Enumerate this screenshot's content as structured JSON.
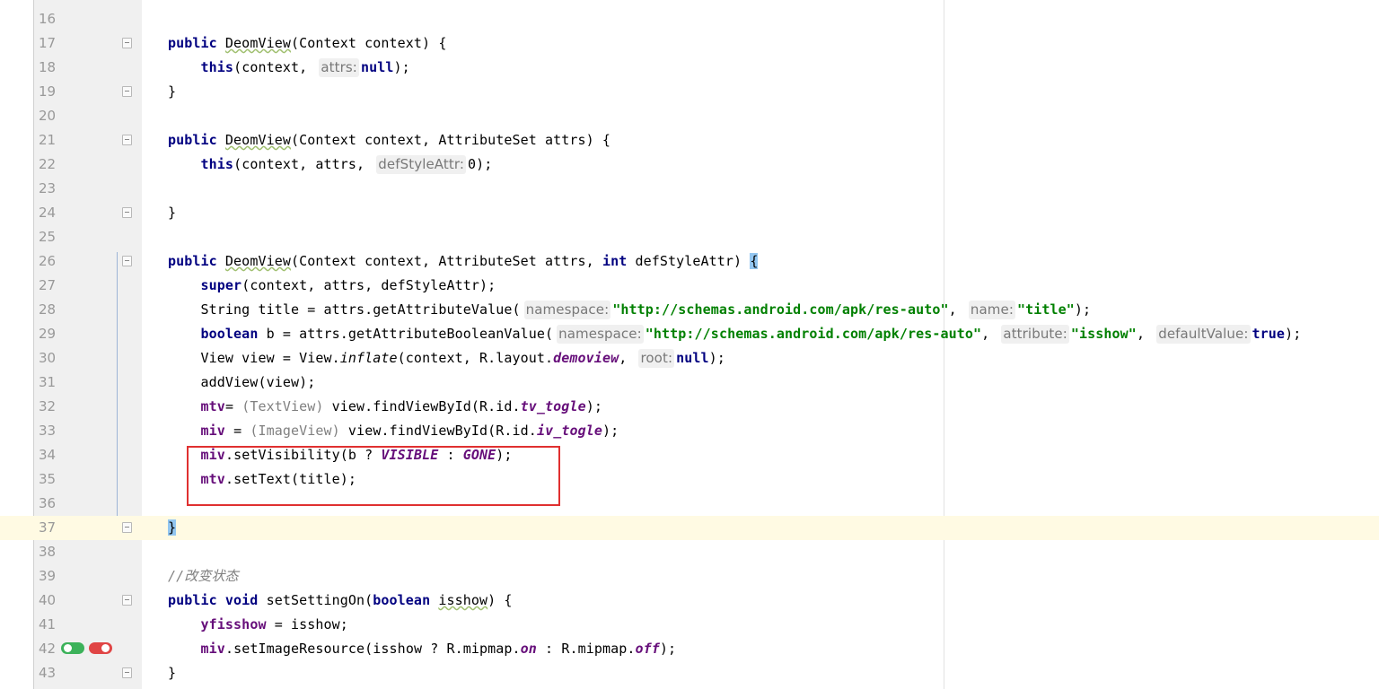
{
  "editor": {
    "lines": [
      {
        "num": "16",
        "segs": []
      },
      {
        "num": "17",
        "fold": true,
        "segs": [
          {
            "t": "public ",
            "c": "kw"
          },
          {
            "t": "DeomView",
            "c": "warn"
          },
          {
            "t": "(Context context) {"
          }
        ]
      },
      {
        "num": "18",
        "segs": [
          {
            "t": "    "
          },
          {
            "t": "this",
            "c": "kw"
          },
          {
            "t": "(context, "
          },
          {
            "t": "attrs:",
            "c": "hint"
          },
          {
            "t": "null",
            "c": "kw"
          },
          {
            "t": ");"
          }
        ]
      },
      {
        "num": "19",
        "fold": true,
        "segs": [
          {
            "t": "}"
          }
        ]
      },
      {
        "num": "20",
        "segs": []
      },
      {
        "num": "21",
        "fold": true,
        "segs": [
          {
            "t": "public ",
            "c": "kw"
          },
          {
            "t": "DeomView",
            "c": "warn"
          },
          {
            "t": "(Context context, AttributeSet attrs) {"
          }
        ]
      },
      {
        "num": "22",
        "segs": [
          {
            "t": "    "
          },
          {
            "t": "this",
            "c": "kw"
          },
          {
            "t": "(context, attrs, "
          },
          {
            "t": "defStyleAttr:",
            "c": "hint"
          },
          {
            "t": "0);"
          }
        ]
      },
      {
        "num": "23",
        "segs": []
      },
      {
        "num": "24",
        "fold": true,
        "segs": [
          {
            "t": "}"
          }
        ]
      },
      {
        "num": "25",
        "segs": []
      },
      {
        "num": "26",
        "fold": true,
        "segs": [
          {
            "t": "public ",
            "c": "kw"
          },
          {
            "t": "DeomView",
            "c": "warn"
          },
          {
            "t": "(Context context, AttributeSet attrs, "
          },
          {
            "t": "int ",
            "c": "kw"
          },
          {
            "t": "defStyleAttr) "
          },
          {
            "t": "{",
            "c": "brace-hl"
          }
        ]
      },
      {
        "num": "27",
        "segs": [
          {
            "t": "    "
          },
          {
            "t": "super",
            "c": "kw"
          },
          {
            "t": "(context, attrs, defStyleAttr);"
          }
        ]
      },
      {
        "num": "28",
        "segs": [
          {
            "t": "    String title = attrs.getAttributeValue("
          },
          {
            "t": "namespace:",
            "c": "hint"
          },
          {
            "t": "\"http://schemas.android.com/apk/res-auto\"",
            "c": "str"
          },
          {
            "t": ", "
          },
          {
            "t": "name:",
            "c": "hint"
          },
          {
            "t": "\"title\"",
            "c": "str"
          },
          {
            "t": ");"
          }
        ]
      },
      {
        "num": "29",
        "segs": [
          {
            "t": "    "
          },
          {
            "t": "boolean ",
            "c": "kw"
          },
          {
            "t": "b = attrs.getAttributeBooleanValue("
          },
          {
            "t": "namespace:",
            "c": "hint"
          },
          {
            "t": "\"http://schemas.android.com/apk/res-auto\"",
            "c": "str"
          },
          {
            "t": ", "
          },
          {
            "t": "attribute:",
            "c": "hint"
          },
          {
            "t": "\"isshow\"",
            "c": "str"
          },
          {
            "t": ", "
          },
          {
            "t": "defaultValue:",
            "c": "hint"
          },
          {
            "t": "true",
            "c": "kw"
          },
          {
            "t": ");"
          }
        ]
      },
      {
        "num": "30",
        "segs": [
          {
            "t": "    View view = View."
          },
          {
            "t": "inflate",
            "c": "ital"
          },
          {
            "t": "(context, R.layout."
          },
          {
            "t": "demoview",
            "c": "stat"
          },
          {
            "t": ", "
          },
          {
            "t": "root:",
            "c": "hint"
          },
          {
            "t": "null",
            "c": "kw"
          },
          {
            "t": ");"
          }
        ]
      },
      {
        "num": "31",
        "segs": [
          {
            "t": "    addView(view);"
          }
        ]
      },
      {
        "num": "32",
        "segs": [
          {
            "t": "    "
          },
          {
            "t": "mtv",
            "c": "fld"
          },
          {
            "t": "= "
          },
          {
            "t": "(TextView)",
            "c": "cast"
          },
          {
            "t": " view.findViewById(R.id."
          },
          {
            "t": "tv_togle",
            "c": "stat"
          },
          {
            "t": ");"
          }
        ]
      },
      {
        "num": "33",
        "segs": [
          {
            "t": "    "
          },
          {
            "t": "miv",
            "c": "fld"
          },
          {
            "t": " = "
          },
          {
            "t": "(ImageView)",
            "c": "cast"
          },
          {
            "t": " view.findViewById(R.id."
          },
          {
            "t": "iv_togle",
            "c": "stat"
          },
          {
            "t": ");"
          }
        ]
      },
      {
        "num": "34",
        "segs": [
          {
            "t": "    "
          },
          {
            "t": "miv",
            "c": "fld"
          },
          {
            "t": ".setVisibility(b ? "
          },
          {
            "t": "VISIBLE",
            "c": "stat"
          },
          {
            "t": " : "
          },
          {
            "t": "GONE",
            "c": "stat"
          },
          {
            "t": ");"
          }
        ]
      },
      {
        "num": "35",
        "segs": [
          {
            "t": "    "
          },
          {
            "t": "mtv",
            "c": "fld"
          },
          {
            "t": ".setText(title);"
          }
        ]
      },
      {
        "num": "36",
        "segs": []
      },
      {
        "num": "37",
        "fold": true,
        "caret": true,
        "segs": [
          {
            "t": "}",
            "c": "brace-hl"
          }
        ]
      },
      {
        "num": "38",
        "segs": []
      },
      {
        "num": "39",
        "segs": [
          {
            "t": "//改变状态",
            "c": "cmt"
          }
        ]
      },
      {
        "num": "40",
        "fold": true,
        "segs": [
          {
            "t": "public void ",
            "c": "kw"
          },
          {
            "t": "setSettingOn("
          },
          {
            "t": "boolean ",
            "c": "kw"
          },
          {
            "t": "isshow",
            "c": "warn"
          },
          {
            "t": ") {"
          }
        ]
      },
      {
        "num": "41",
        "segs": [
          {
            "t": "    "
          },
          {
            "t": "yfisshow",
            "c": "fld"
          },
          {
            "t": " = isshow;"
          }
        ]
      },
      {
        "num": "42",
        "segs": [
          {
            "t": "    "
          },
          {
            "t": "miv",
            "c": "fld"
          },
          {
            "t": ".setImageResource(isshow ? R.mipmap."
          },
          {
            "t": "on",
            "c": "stat"
          },
          {
            "t": " : R.mipmap."
          },
          {
            "t": "off",
            "c": "stat"
          },
          {
            "t": ");"
          }
        ]
      },
      {
        "num": "43",
        "fold": true,
        "segs": [
          {
            "t": "}"
          }
        ]
      }
    ],
    "colors": {
      "keyword": "#000080",
      "string": "#008000",
      "field": "#660e7a",
      "comment": "#808080",
      "caret_row": "#fffae3",
      "highlight_box": "#e03030"
    },
    "gutter_icons": [
      {
        "name": "toggle-on-icon",
        "color": "#3cb25a"
      },
      {
        "name": "toggle-off-icon",
        "color": "#e04545"
      }
    ]
  }
}
